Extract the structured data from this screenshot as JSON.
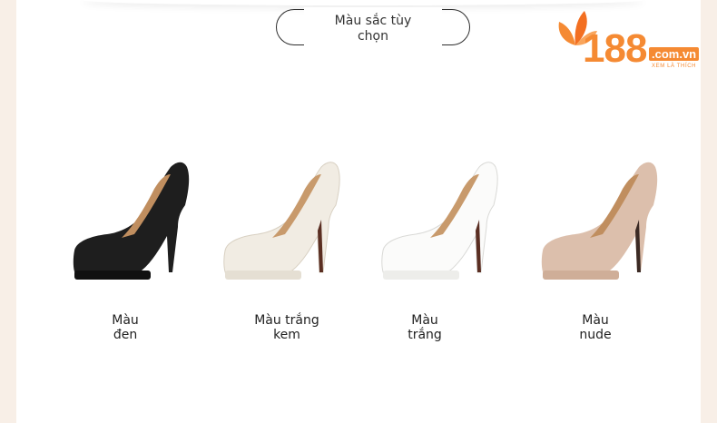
{
  "header": {
    "title_line1": "Màu sắc tùy",
    "title_line2": "chọn"
  },
  "logo": {
    "number": "188",
    "domain": ".com.vn",
    "tagline": "XEM LÀ THÍCH",
    "brand_color": "#f58a33"
  },
  "products": [
    {
      "line1": "Màu",
      "line2": "đen",
      "color": "#1e1e1e"
    },
    {
      "line1": "Màu trắng",
      "line2": "kem",
      "color": "#f1ece3"
    },
    {
      "line1": "Màu",
      "line2": "trắng",
      "color": "#fbfbfa"
    },
    {
      "line1": "Màu",
      "line2": "nude",
      "color": "#dcbfac"
    }
  ]
}
